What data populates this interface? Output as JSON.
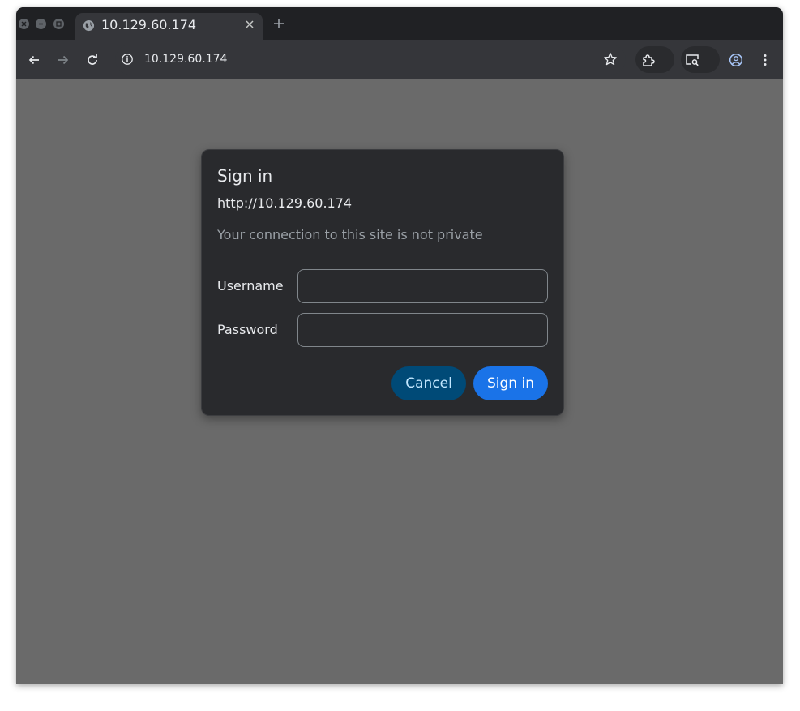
{
  "browser": {
    "tab": {
      "title": "10.129.60.174",
      "favicon": "globe-icon",
      "close_icon": "close-icon"
    },
    "new_tab_icon": "plus-icon",
    "window_controls": [
      "close-icon",
      "minimize-icon",
      "maximize-icon"
    ],
    "toolbar": {
      "back_icon": "arrow-back-icon",
      "forward_icon": "arrow-forward-icon",
      "reload_icon": "reload-icon",
      "url": "10.129.60.174",
      "site_info_icon": "info-icon",
      "bookmark_icon": "star-icon",
      "extensions_icon": "puzzle-icon",
      "search_tab_icon": "tab-search-icon",
      "profile_icon": "account-icon",
      "menu_icon": "kebab-menu-icon"
    }
  },
  "dialog": {
    "title": "Sign in",
    "origin": "http://10.129.60.174",
    "warning": "Your connection to this site is not private",
    "username_label": "Username",
    "username_value": "",
    "password_label": "Password",
    "password_value": "",
    "cancel_label": "Cancel",
    "signin_label": "Sign in"
  },
  "colors": {
    "chrome_dark": "#202124",
    "toolbar": "#35363a",
    "page_background": "#6a6a6a",
    "dialog_background": "#292a2d",
    "primary_button": "#1a73e8",
    "tonal_button": "#004a77"
  }
}
